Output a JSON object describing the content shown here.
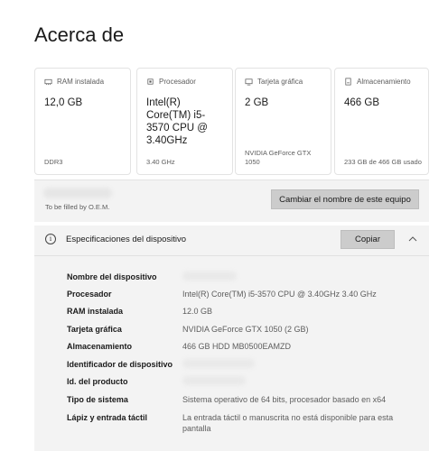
{
  "page": {
    "title": "Acerca de"
  },
  "cards": [
    {
      "label": "RAM instalada",
      "icon": "ram-icon",
      "value": "12,0 GB",
      "footer": "DDR3"
    },
    {
      "label": "Procesador",
      "icon": "processor-icon",
      "value": "Intel(R) Core(TM) i5-3570 CPU @ 3.40GHz",
      "footer": "3.40 GHz"
    },
    {
      "label": "Tarjeta gráfica",
      "icon": "graphics-card-icon",
      "value": "2 GB",
      "footer": "NVIDIA GeForce GTX 1050"
    },
    {
      "label": "Almacenamiento",
      "icon": "storage-icon",
      "value": "466 GB",
      "footer": "233 GB de 466 GB usado"
    }
  ],
  "device_name": {
    "subtitle": "To be filled by O.E.M.",
    "rename_button": "Cambiar el nombre de este equipo"
  },
  "specs": {
    "title": "Especificaciones del dispositivo",
    "copy_button": "Copiar",
    "rows": [
      {
        "label": "Nombre del dispositivo",
        "value": ""
      },
      {
        "label": "Procesador",
        "value": "Intel(R) Core(TM) i5-3570 CPU @ 3.40GHz   3.40 GHz"
      },
      {
        "label": "RAM instalada",
        "value": "12.0 GB"
      },
      {
        "label": "Tarjeta gráfica",
        "value": "NVIDIA GeForce GTX 1050 (2 GB)"
      },
      {
        "label": "Almacenamiento",
        "value": "466 GB HDD MB0500EAMZD"
      },
      {
        "label": "Identificador de dispositivo",
        "value": ""
      },
      {
        "label": "Id. del producto",
        "value": ""
      },
      {
        "label": "Tipo de sistema",
        "value": "Sistema operativo de 64 bits, procesador basado en x64"
      },
      {
        "label": "Lápiz y entrada táctil",
        "value": "La entrada táctil o manuscrita no está disponible para esta pantalla"
      }
    ]
  }
}
